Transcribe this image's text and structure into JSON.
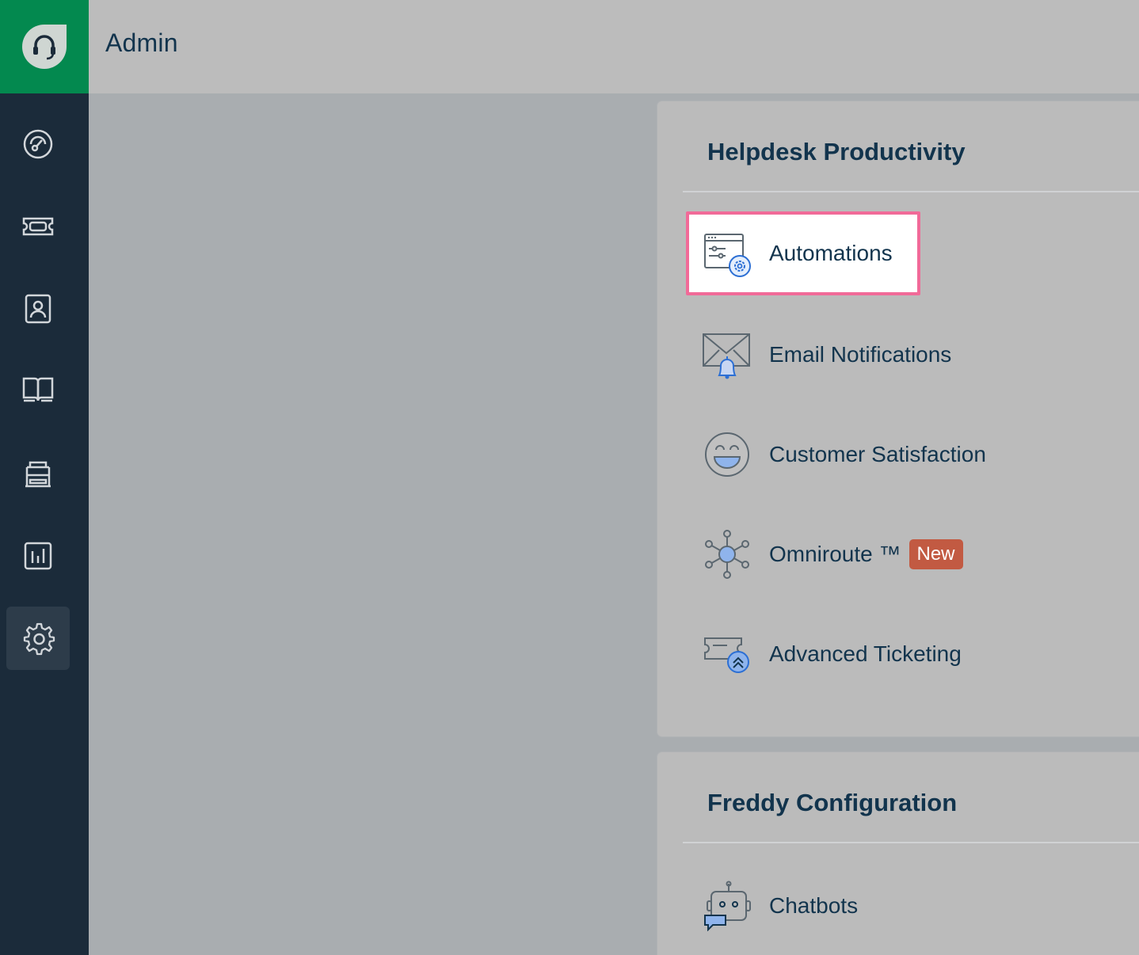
{
  "topbar": {
    "title": "Admin"
  },
  "sidebar": {
    "items": [
      {
        "icon": "dashboard-icon"
      },
      {
        "icon": "ticket-icon"
      },
      {
        "icon": "contacts-icon"
      },
      {
        "icon": "solutions-book-icon"
      },
      {
        "icon": "forums-icon"
      },
      {
        "icon": "reports-icon"
      },
      {
        "icon": "admin-gear-icon",
        "active": true
      }
    ]
  },
  "sections": [
    {
      "title": "Helpdesk Productivity",
      "items": [
        {
          "label": "Automations",
          "icon": "automations-icon",
          "highlighted": true
        },
        {
          "label": "Email Notifications",
          "icon": "email-notifications-icon"
        },
        {
          "label": "Customer Satisfaction",
          "icon": "customer-satisfaction-icon"
        },
        {
          "label": "Omniroute ™",
          "icon": "omniroute-icon",
          "badge": "New"
        },
        {
          "label": "Advanced Ticketing",
          "icon": "advanced-ticketing-icon"
        }
      ]
    },
    {
      "title": "Freddy Configuration",
      "items": [
        {
          "label": "Chatbots",
          "icon": "chatbot-icon"
        }
      ]
    }
  ],
  "colors": {
    "brand": "#03894f",
    "sidebar": "#1b2b3a",
    "highlight_border": "#f16a98",
    "badge": "#c25a42"
  }
}
